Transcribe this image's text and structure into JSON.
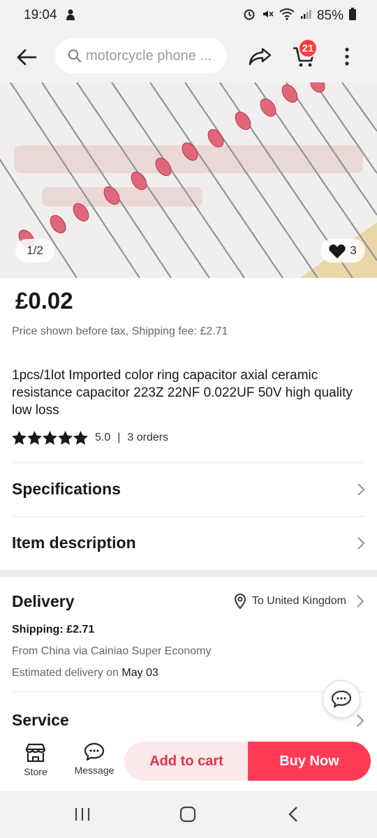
{
  "status_bar": {
    "time": "19:04",
    "battery": "85%"
  },
  "top_bar": {
    "search_placeholder": "motorcycle phone ...",
    "cart_count": "21"
  },
  "gallery": {
    "pager": "1/2",
    "favorites": "3"
  },
  "product": {
    "price": "£0.02",
    "tax_note": "Price shown before tax, Shipping fee:  £2.71",
    "title": "1pcs/1lot Imported color ring capacitor axial ceramic resistance capacitor 223Z 22NF 0.022UF 50V high quality low loss",
    "rating": "5.0",
    "rating_stars": 5,
    "orders": "3 orders"
  },
  "sections": {
    "specifications": "Specifications",
    "item_description": "Item description"
  },
  "delivery": {
    "heading": "Delivery",
    "destination": "To United Kingdom",
    "shipping_label": "Shipping:",
    "shipping_value": "£2.71",
    "from_text": "From China via Cainiao Super Economy",
    "estimated_label": "Estimated delivery on",
    "estimated_date": "May 03",
    "service": "Service"
  },
  "bottom_bar": {
    "store": "Store",
    "message": "Message",
    "add_to_cart": "Add to cart",
    "buy_now": "Buy Now"
  },
  "colors": {
    "accent": "#fe3a55",
    "accent_light": "#fde8ea",
    "badge": "#ff3b3b"
  }
}
